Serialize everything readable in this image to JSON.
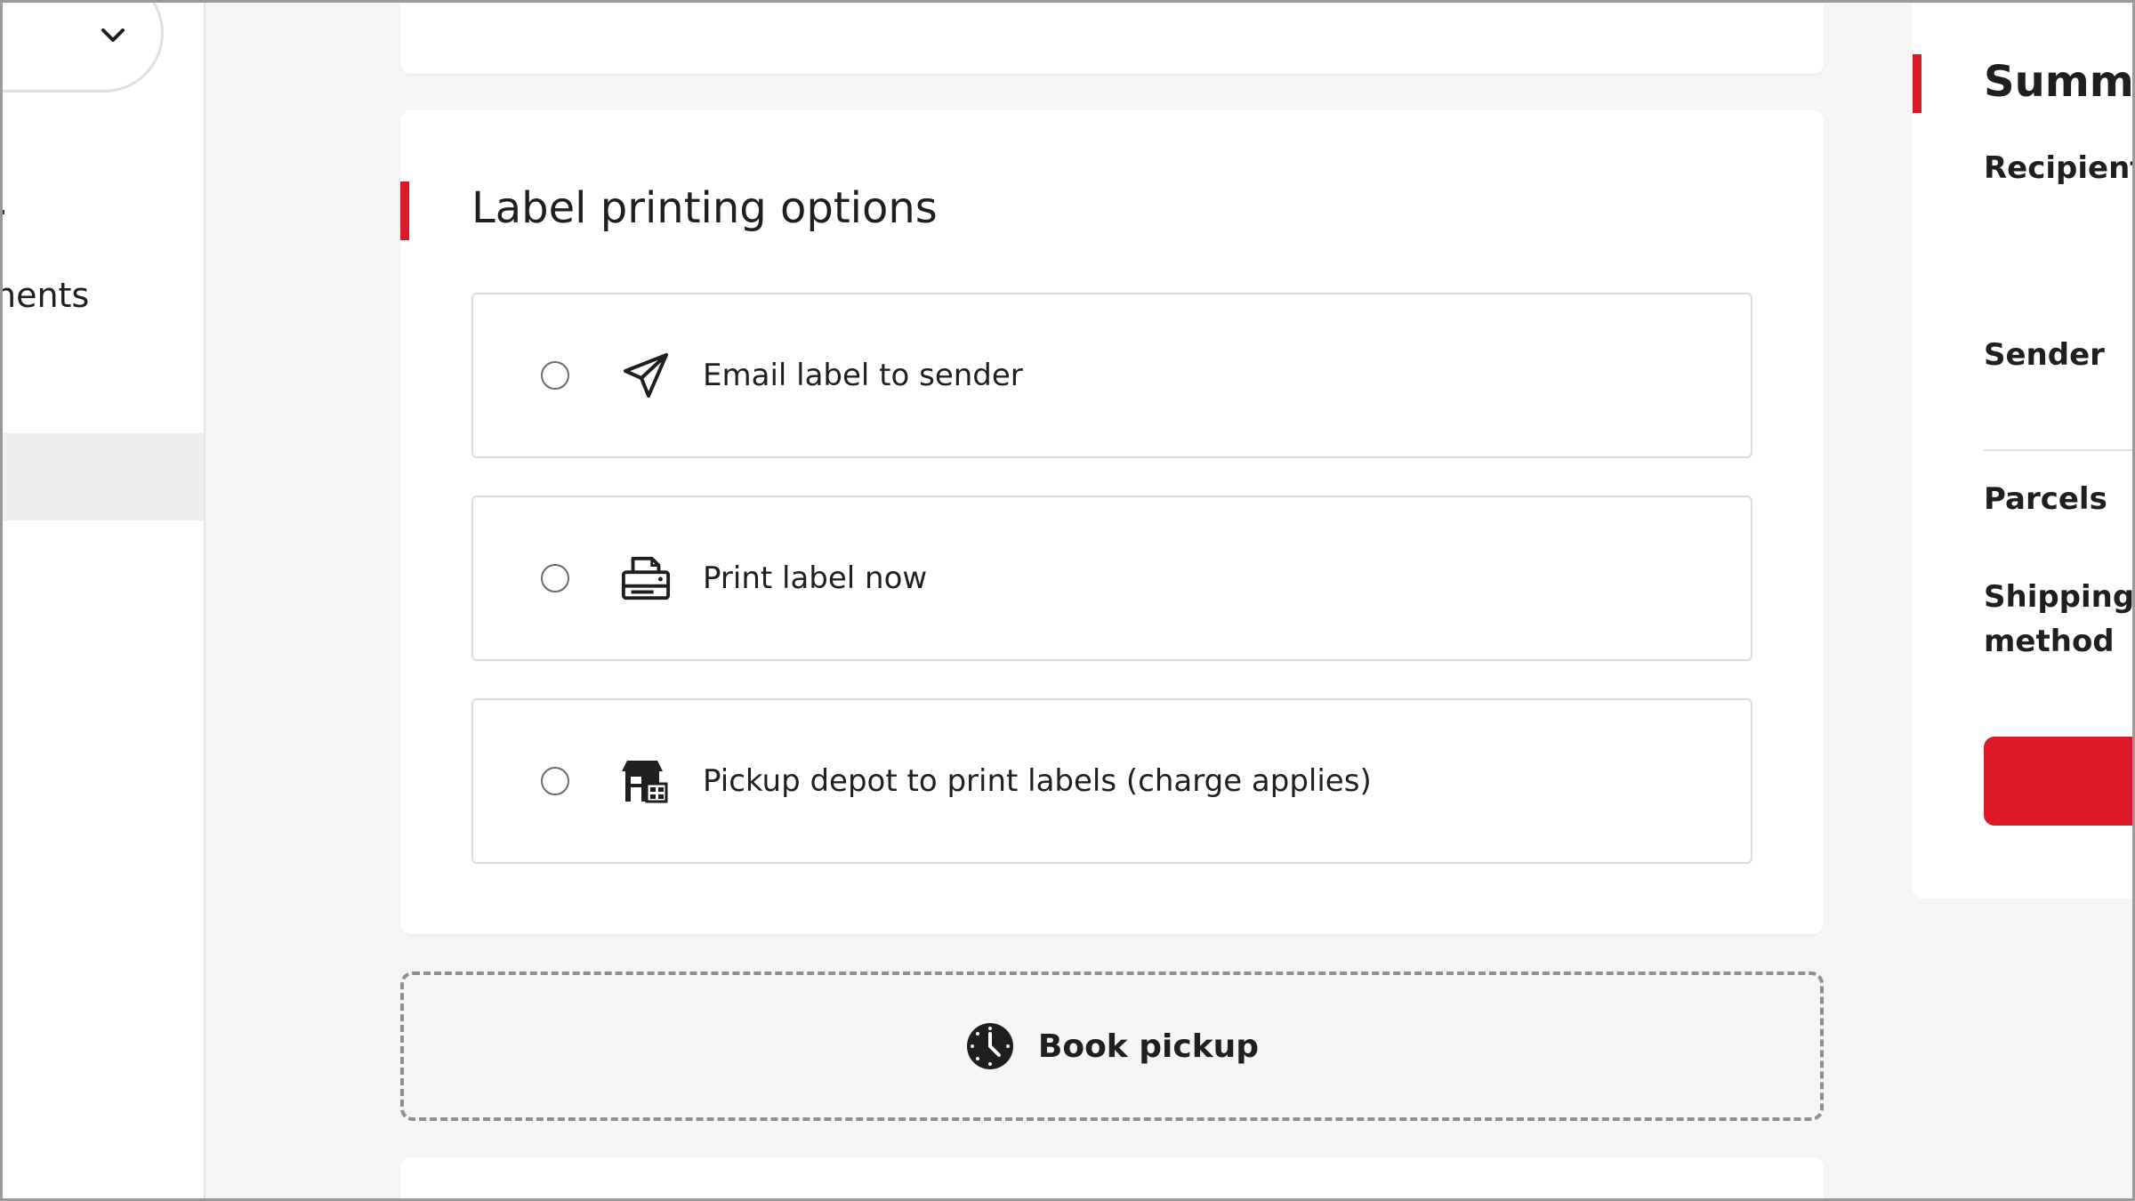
{
  "sidebar": {
    "partial_item_label": "nents"
  },
  "label_printing": {
    "title": "Label printing options",
    "options": [
      {
        "label": "Email label to sender",
        "icon": "send-icon"
      },
      {
        "label": "Print label now",
        "icon": "printer-icon"
      },
      {
        "label": "Pickup depot to print labels (charge applies)",
        "icon": "depot-icon"
      }
    ]
  },
  "book_pickup": {
    "label": "Book pickup",
    "icon": "clock-icon"
  },
  "summary": {
    "title": "Summa",
    "recipient_label": "Recipient",
    "sender_label": "Sender",
    "parcels_label": "Parcels",
    "shipping_method_label_line1": "Shipping",
    "shipping_method_label_line2": "method"
  },
  "colors": {
    "accent": "#dc1928",
    "page_background": "#f5f5f5",
    "card_background": "#ffffff"
  }
}
